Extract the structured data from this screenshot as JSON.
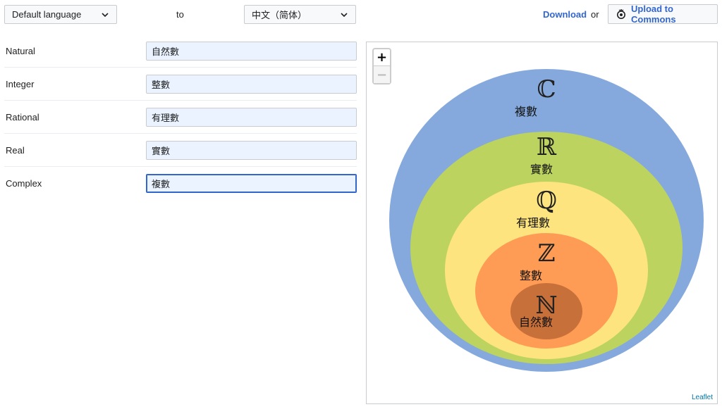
{
  "toolbar": {
    "source_language": "Default language",
    "to_label": "to",
    "target_language": "中文（简体）",
    "download_label": "Download",
    "or_label": "or",
    "upload_label": "Upload to Commons"
  },
  "rows": [
    {
      "label": "Natural",
      "value": "自然數"
    },
    {
      "label": "Integer",
      "value": "整數"
    },
    {
      "label": "Rational",
      "value": "有理數"
    },
    {
      "label": "Real",
      "value": "實數"
    },
    {
      "label": "Complex",
      "value": "複數"
    }
  ],
  "map": {
    "zoom_in": "+",
    "zoom_out": "−",
    "attribution": "Leaflet",
    "sets": [
      {
        "letter": "ℂ",
        "sublabel": "複數",
        "color": "#85a9dd"
      },
      {
        "letter": "ℝ",
        "sublabel": "實數",
        "color": "#bcd35f"
      },
      {
        "letter": "ℚ",
        "sublabel": "有理數",
        "color": "#fde47f"
      },
      {
        "letter": "ℤ",
        "sublabel": "整數",
        "color": "#fe9b55"
      },
      {
        "letter": "ℕ",
        "sublabel": "自然數",
        "color": "#c8703a"
      }
    ]
  }
}
